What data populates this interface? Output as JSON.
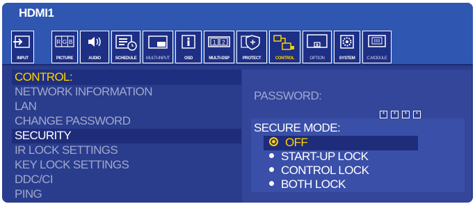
{
  "window": {
    "title": "HDMI1"
  },
  "toolbar": {
    "items": [
      {
        "label": "INPUT",
        "icon": "input-icon"
      },
      {
        "label": "PICTURE",
        "icon": "picture-rgb-icon"
      },
      {
        "label": "AUDIO",
        "icon": "speaker-icon"
      },
      {
        "label": "SCHEDULE",
        "icon": "schedule-icon"
      },
      {
        "label": "MULTI-INPUT",
        "icon": "multi-input-icon"
      },
      {
        "label": "OSD",
        "icon": "info-icon"
      },
      {
        "label": "MULTI-DSP",
        "icon": "multi-display-icon"
      },
      {
        "label": "PROTECT",
        "icon": "shield-icon"
      },
      {
        "label": "CONTROL",
        "icon": "control-icon"
      },
      {
        "label": "OPTION",
        "icon": "option-icon"
      },
      {
        "label": "SYSTEM",
        "icon": "gear-icon"
      },
      {
        "label": "C.MODULE",
        "icon": "compute-module-icon"
      }
    ],
    "active": "CONTROL"
  },
  "menu": {
    "header": "CONTROL:",
    "items": [
      "NETWORK INFORMATION",
      "LAN",
      "CHANGE PASSWORD",
      "SECURITY",
      "IR LOCK SETTINGS",
      "KEY LOCK SETTINGS",
      "DDC/CI",
      "PING"
    ],
    "selected": "SECURITY"
  },
  "settings": {
    "password_label": "PASSWORD:",
    "password_mask": [
      "*",
      "*",
      "*",
      "*"
    ],
    "secure_mode_label": "SECURE MODE:",
    "secure_mode_options": [
      "OFF",
      "START-UP LOCK",
      "CONTROL LOCK",
      "BOTH LOCK"
    ],
    "secure_mode_selected": "OFF"
  },
  "colors": {
    "background": "#2a3c8c",
    "header_bar": "#2f56b0",
    "highlight": "#1e2c7a",
    "accent_yellow": "#ffd200",
    "inactive_text": "#9fa8cc",
    "text": "#ffffff"
  }
}
